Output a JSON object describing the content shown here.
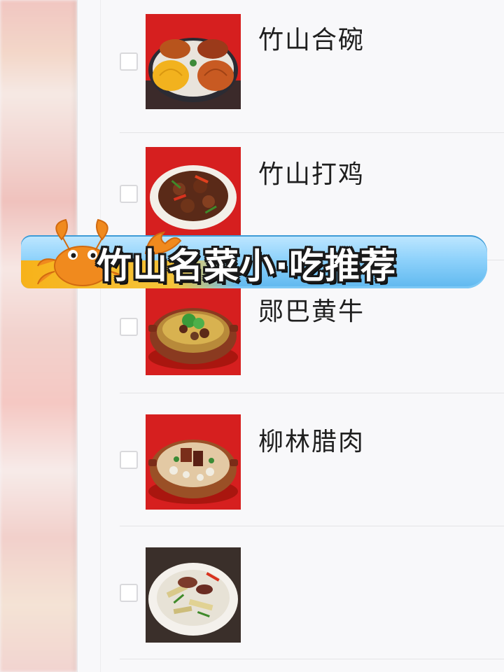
{
  "banner": {
    "title": "竹山名菜小·吃推荐"
  },
  "dishes": [
    {
      "name": "竹山合碗",
      "checked": false,
      "thumb_icon": "bowl-set-image"
    },
    {
      "name": "竹山打鸡",
      "checked": false,
      "thumb_icon": "stir-fry-chicken-image"
    },
    {
      "name": "郧巴黄牛",
      "checked": false,
      "thumb_icon": "beef-pot-image"
    },
    {
      "name": "柳林腊肉",
      "checked": false,
      "thumb_icon": "cured-pork-pot-image"
    },
    {
      "name": "",
      "checked": false,
      "thumb_icon": "bamboo-shoot-pork-image"
    }
  ],
  "colors": {
    "thumb_bg_red": "#d61f1f",
    "banner_blue": "#8fd2fb",
    "banner_yellow": "#f5c43a",
    "crab_orange": "#f08a1e"
  }
}
